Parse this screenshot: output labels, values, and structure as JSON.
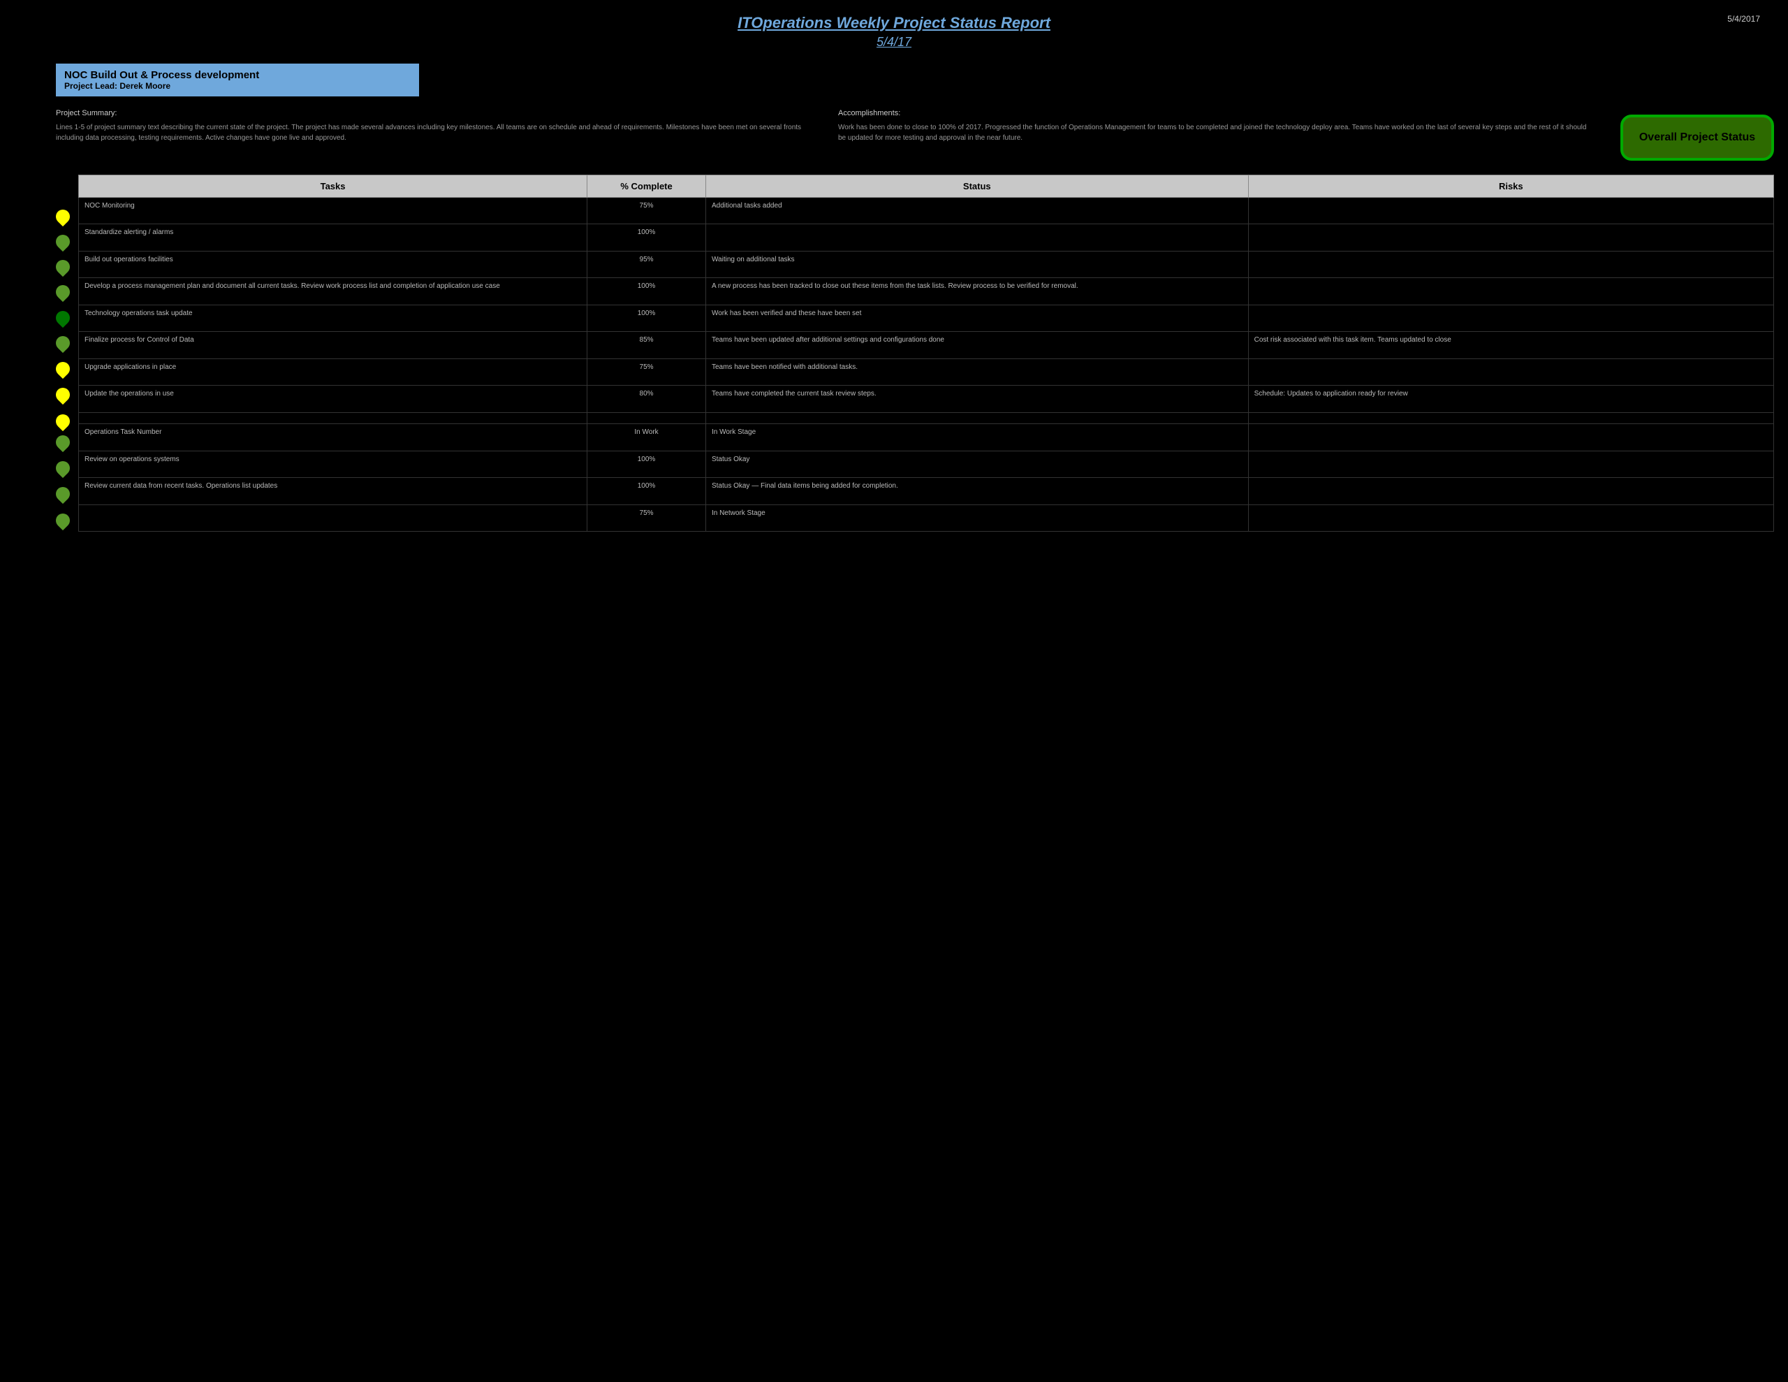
{
  "header": {
    "title": "ITOperations Weekly Project Status Report",
    "subtitle": "5/4/17",
    "date": "5/4/2017"
  },
  "project": {
    "name": "NOC Build Out & Process development",
    "lead_label": "Project Lead:",
    "lead_name": "Derek Moore"
  },
  "summary": {
    "title": "Project Summary:",
    "text": "Lines 1-5 of project summary text describing the current state of the project. The project has made several advances including key milestones. All teams are on schedule and ahead of requirements. Milestones have been met on several fronts including data processing, testing requirements. Active changes have gone live and approved."
  },
  "accomplishments": {
    "title": "Accomplishments:",
    "text": "Work has been done to close to 100% of 2017. Progressed the function of Operations Management for teams to be completed and joined the technology deploy area. Teams have worked on the last of several key steps and the rest of it should be updated for more testing and approval in the near future."
  },
  "overall_status": {
    "label": "Overall Project Status"
  },
  "table": {
    "headers": [
      "Tasks",
      "% Complete",
      "Status",
      "Risks"
    ],
    "rows": [
      {
        "dot": "yellow",
        "task": "NOC Monitoring",
        "pct": "75%",
        "status": "Additional tasks added",
        "risks": ""
      },
      {
        "dot": "green-light",
        "task": "Standardize alerting / alarms",
        "pct": "100%",
        "status": "",
        "risks": ""
      },
      {
        "dot": "green-light",
        "task": "Build out operations facilities",
        "pct": "95%",
        "status": "Waiting on additional tasks",
        "risks": ""
      },
      {
        "dot": "green-light",
        "task": "Develop a process management plan and document all current tasks. Review work process list and completion of application use case",
        "pct": "100%",
        "status": "A new process has been tracked to close out these items from the task lists. Review process to be verified for removal.",
        "risks": ""
      },
      {
        "dot": "green",
        "task": "Technology operations task update",
        "pct": "100%",
        "status": "Work has been verified and these have been set",
        "risks": ""
      },
      {
        "dot": "green-light",
        "task": "Finalize process for Control of Data",
        "pct": "85%",
        "status": "Teams have been updated after additional settings and configurations done",
        "risks": "Cost risk associated with this task item. Teams updated to close"
      },
      {
        "dot": "yellow",
        "task": "Upgrade applications in place",
        "pct": "75%",
        "status": "Teams have been notified with additional tasks.",
        "risks": ""
      },
      {
        "dot": "yellow",
        "task": "Update the operations in use",
        "pct": "80%",
        "status": "Teams have completed the current task review steps.",
        "risks": "Schedule: Updates to application ready for review"
      },
      {
        "dot": "yellow",
        "task": "",
        "pct": "",
        "status": "",
        "risks": ""
      },
      {
        "dot": "green-light",
        "task": "Operations Task Number",
        "pct": "In Work",
        "status": "In Work Stage",
        "risks": ""
      },
      {
        "dot": "green-light",
        "task": "Review on operations systems",
        "pct": "100%",
        "status": "Status Okay",
        "risks": ""
      },
      {
        "dot": "green-light",
        "task": "Review current data from recent tasks. Operations list updates",
        "pct": "100%",
        "status": "Status Okay — Final data items being added for completion.",
        "risks": ""
      },
      {
        "dot": "green-light",
        "task": "",
        "pct": "75%",
        "status": "In Network Stage",
        "risks": ""
      }
    ]
  }
}
